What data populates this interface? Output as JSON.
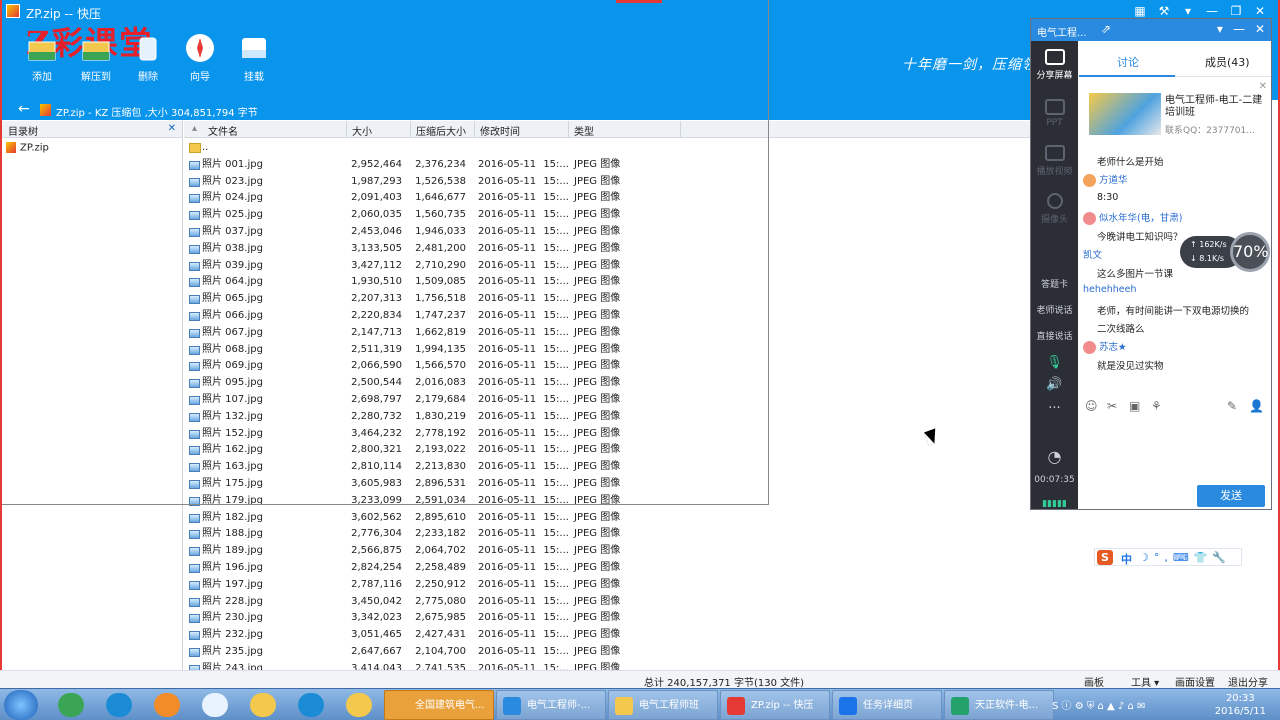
{
  "window": {
    "title": "ZP.zip -- 快压",
    "watermark": "Z彩课堂",
    "slogan": "十年磨一剑，压缩领",
    "controls": [
      "▦",
      "⚒",
      "▾",
      "—",
      "❐",
      "✕"
    ]
  },
  "toolbar": {
    "buttons": [
      {
        "label": "添加",
        "icon": "add-icon"
      },
      {
        "label": "解压到",
        "icon": "extract-icon"
      },
      {
        "label": "删除",
        "icon": "delete-icon"
      },
      {
        "label": "向导",
        "icon": "wizard-icon"
      },
      {
        "label": "挂载",
        "icon": "mount-icon"
      }
    ]
  },
  "address": {
    "back": "←",
    "path": "ZP.zip - KZ 压缩包 ,大小 304,851,794 字节"
  },
  "tree": {
    "header": "目录树",
    "close": "✕",
    "root": "ZP.zip"
  },
  "list": {
    "columns": {
      "name": "文件名",
      "size": "大小",
      "compressed": "压缩后大小",
      "modified": "修改时间",
      "type": "类型"
    },
    "parent": "..",
    "files": [
      {
        "name": "照片 001.jpg",
        "size": "2,952,464",
        "comp": "2,376,234",
        "date": "2016-05-11",
        "time": "15:...",
        "type": "JPEG 图像"
      },
      {
        "name": "照片 023.jpg",
        "size": "1,987,293",
        "comp": "1,526,538",
        "date": "2016-05-11",
        "time": "15:...",
        "type": "JPEG 图像"
      },
      {
        "name": "照片 024.jpg",
        "size": "2,091,403",
        "comp": "1,646,677",
        "date": "2016-05-11",
        "time": "15:...",
        "type": "JPEG 图像"
      },
      {
        "name": "照片 025.jpg",
        "size": "2,060,035",
        "comp": "1,560,735",
        "date": "2016-05-11",
        "time": "15:...",
        "type": "JPEG 图像"
      },
      {
        "name": "照片 037.jpg",
        "size": "2,453,046",
        "comp": "1,946,033",
        "date": "2016-05-11",
        "time": "15:...",
        "type": "JPEG 图像"
      },
      {
        "name": "照片 038.jpg",
        "size": "3,133,505",
        "comp": "2,481,200",
        "date": "2016-05-11",
        "time": "15:...",
        "type": "JPEG 图像"
      },
      {
        "name": "照片 039.jpg",
        "size": "3,427,112",
        "comp": "2,710,290",
        "date": "2016-05-11",
        "time": "15:...",
        "type": "JPEG 图像"
      },
      {
        "name": "照片 064.jpg",
        "size": "1,930,510",
        "comp": "1,509,085",
        "date": "2016-05-11",
        "time": "15:...",
        "type": "JPEG 图像"
      },
      {
        "name": "照片 065.jpg",
        "size": "2,207,313",
        "comp": "1,756,518",
        "date": "2016-05-11",
        "time": "15:...",
        "type": "JPEG 图像"
      },
      {
        "name": "照片 066.jpg",
        "size": "2,220,834",
        "comp": "1,747,237",
        "date": "2016-05-11",
        "time": "15:...",
        "type": "JPEG 图像"
      },
      {
        "name": "照片 067.jpg",
        "size": "2,147,713",
        "comp": "1,662,819",
        "date": "2016-05-11",
        "time": "15:...",
        "type": "JPEG 图像"
      },
      {
        "name": "照片 068.jpg",
        "size": "2,511,319",
        "comp": "1,994,135",
        "date": "2016-05-11",
        "time": "15:...",
        "type": "JPEG 图像"
      },
      {
        "name": "照片 069.jpg",
        "size": "2,066,590",
        "comp": "1,566,570",
        "date": "2016-05-11",
        "time": "15:...",
        "type": "JPEG 图像"
      },
      {
        "name": "照片 095.jpg",
        "size": "2,500,544",
        "comp": "2,016,083",
        "date": "2016-05-11",
        "time": "15:...",
        "type": "JPEG 图像"
      },
      {
        "name": "照片 107.jpg",
        "size": "2,698,797",
        "comp": "2,179,684",
        "date": "2016-05-11",
        "time": "15:...",
        "type": "JPEG 图像"
      },
      {
        "name": "照片 132.jpg",
        "size": "2,280,732",
        "comp": "1,830,219",
        "date": "2016-05-11",
        "time": "15:...",
        "type": "JPEG 图像"
      },
      {
        "name": "照片 152.jpg",
        "size": "3,464,232",
        "comp": "2,778,192",
        "date": "2016-05-11",
        "time": "15:...",
        "type": "JPEG 图像"
      },
      {
        "name": "照片 162.jpg",
        "size": "2,800,321",
        "comp": "2,193,022",
        "date": "2016-05-11",
        "time": "15:...",
        "type": "JPEG 图像"
      },
      {
        "name": "照片 163.jpg",
        "size": "2,810,114",
        "comp": "2,213,830",
        "date": "2016-05-11",
        "time": "15:...",
        "type": "JPEG 图像"
      },
      {
        "name": "照片 175.jpg",
        "size": "3,605,983",
        "comp": "2,896,531",
        "date": "2016-05-11",
        "time": "15:...",
        "type": "JPEG 图像"
      },
      {
        "name": "照片 179.jpg",
        "size": "3,233,099",
        "comp": "2,591,034",
        "date": "2016-05-11",
        "time": "15:...",
        "type": "JPEG 图像"
      },
      {
        "name": "照片 182.jpg",
        "size": "3,602,562",
        "comp": "2,895,610",
        "date": "2016-05-11",
        "time": "15:...",
        "type": "JPEG 图像"
      },
      {
        "name": "照片 188.jpg",
        "size": "2,776,304",
        "comp": "2,233,182",
        "date": "2016-05-11",
        "time": "15:...",
        "type": "JPEG 图像"
      },
      {
        "name": "照片 189.jpg",
        "size": "2,566,875",
        "comp": "2,064,702",
        "date": "2016-05-11",
        "time": "15:...",
        "type": "JPEG 图像"
      },
      {
        "name": "照片 196.jpg",
        "size": "2,824,254",
        "comp": "2,258,489",
        "date": "2016-05-11",
        "time": "15:...",
        "type": "JPEG 图像"
      },
      {
        "name": "照片 197.jpg",
        "size": "2,787,116",
        "comp": "2,250,912",
        "date": "2016-05-11",
        "time": "15:...",
        "type": "JPEG 图像"
      },
      {
        "name": "照片 228.jpg",
        "size": "3,450,042",
        "comp": "2,775,080",
        "date": "2016-05-11",
        "time": "15:...",
        "type": "JPEG 图像"
      },
      {
        "name": "照片 230.jpg",
        "size": "3,342,023",
        "comp": "2,675,985",
        "date": "2016-05-11",
        "time": "15:...",
        "type": "JPEG 图像"
      },
      {
        "name": "照片 232.jpg",
        "size": "3,051,465",
        "comp": "2,427,431",
        "date": "2016-05-11",
        "time": "15:...",
        "type": "JPEG 图像"
      },
      {
        "name": "照片 235.jpg",
        "size": "2,647,667",
        "comp": "2,104,700",
        "date": "2016-05-11",
        "time": "15:...",
        "type": "JPEG 图像"
      },
      {
        "name": "照片 243.jpg",
        "size": "3,414,043",
        "comp": "2,741,535",
        "date": "2016-05-11",
        "time": "15:...",
        "type": "JPEG 图像"
      }
    ]
  },
  "status": {
    "total": "总计  240,157,371 字节(130 文件)",
    "buttons": [
      "画板",
      "工具 ▾",
      "画面设置",
      "退出分享"
    ]
  },
  "chat": {
    "title": "电气工程...",
    "controls": [
      "▾",
      "—",
      "✕"
    ],
    "side": [
      {
        "label": "分享屏幕",
        "active": true
      },
      {
        "label": "PPT",
        "active": false
      },
      {
        "label": "播放视频",
        "active": false
      },
      {
        "label": "摄像头",
        "active": false
      },
      {
        "label": "答题卡",
        "active": true
      },
      {
        "label": "老师说话",
        "active": true
      },
      {
        "label": "直接说话",
        "active": true
      }
    ],
    "timer": "00:07:35",
    "tabs": {
      "discuss": "讨论",
      "members": "成员(43)"
    },
    "ad": {
      "title": "电气工程师-电工-二建培训班",
      "qq": "联系QQ：2377701..."
    },
    "messages": [
      {
        "kind": "text",
        "text": "老师什么是开始"
      },
      {
        "kind": "name",
        "text": "方道华"
      },
      {
        "kind": "text",
        "text": "8:30"
      },
      {
        "kind": "name",
        "text": "似水年华(电，甘肃)"
      },
      {
        "kind": "text",
        "text": "今晚讲电工知识吗？"
      },
      {
        "kind": "name",
        "text": "凯文"
      },
      {
        "kind": "text",
        "text": "这么多图片一节课"
      },
      {
        "kind": "name",
        "text": "hehehheeh"
      },
      {
        "kind": "text",
        "text": "老师，有时间能讲一下双电源切换的"
      },
      {
        "kind": "text",
        "text": "二次线路么"
      },
      {
        "kind": "name",
        "text": "苏志★"
      },
      {
        "kind": "text",
        "text": "就是没见过实物"
      }
    ],
    "send": "发送"
  },
  "meter": {
    "up": "↑ 162K/s",
    "down": "↓ 8.1K/s",
    "percent": "70%"
  },
  "ime": {
    "logo": "S",
    "mode": "中",
    "extras": "☽°,⌨👕🔧"
  },
  "taskbar": {
    "tasks": [
      {
        "label": "全国建筑电气...",
        "color": "#e8a13b",
        "active": true
      },
      {
        "label": "电气工程师-...",
        "color": "#2a8ae0",
        "active": false
      },
      {
        "label": "电气工程师班",
        "color": "#f2c94c",
        "active": false
      },
      {
        "label": "ZP.zip -- 快压",
        "color": "#e53935",
        "active": false
      },
      {
        "label": "任务详细页",
        "color": "#1a73e8",
        "active": false
      },
      {
        "label": "天正软件-电...",
        "color": "#23a36b",
        "active": false
      }
    ],
    "clock_time": "20:33",
    "clock_date": "2016/5/11"
  }
}
